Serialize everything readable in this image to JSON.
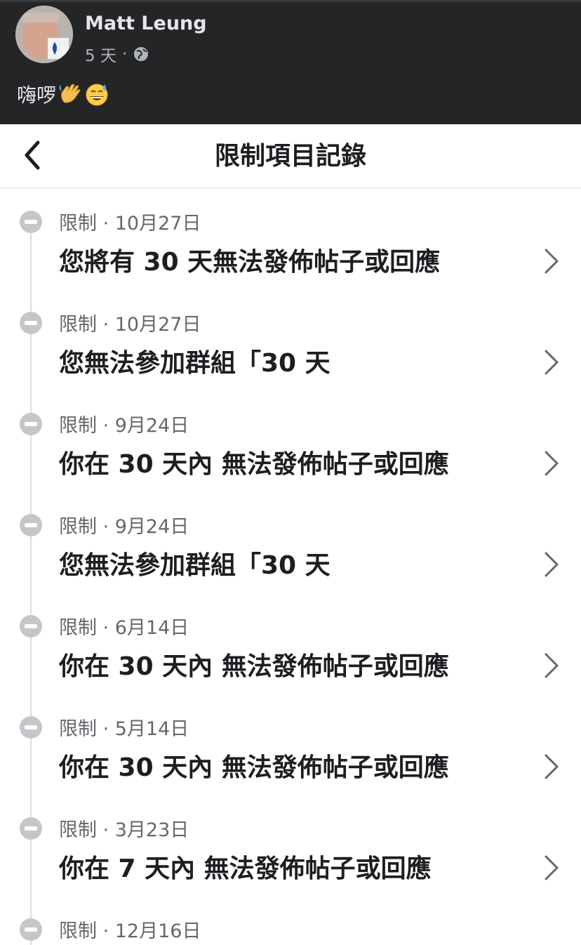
{
  "post": {
    "author": "Matt Leung",
    "time": "5 天",
    "separator": "·",
    "audience_icon": "globe-icon",
    "text": "嗨啰",
    "emojis": [
      "waving-hand-emoji",
      "grinning-sweat-emoji"
    ]
  },
  "header": {
    "title": "限制項目記錄",
    "back_icon": "chevron-left-icon"
  },
  "items": [
    {
      "label": "限制",
      "date": "10月27日",
      "text": "您將有 30 天無法發佈帖子或回應"
    },
    {
      "label": "限制",
      "date": "10月27日",
      "text": "您無法參加群組「30 天"
    },
    {
      "label": "限制",
      "date": "9月24日",
      "text": "你在 30 天內 無法發佈帖子或回應"
    },
    {
      "label": "限制",
      "date": "9月24日",
      "text": "您無法參加群組「30 天"
    },
    {
      "label": "限制",
      "date": "6月14日",
      "text": "你在 30 天內 無法發佈帖子或回應"
    },
    {
      "label": "限制",
      "date": "5月14日",
      "text": "你在 30 天內 無法發佈帖子或回應"
    },
    {
      "label": "限制",
      "date": "3月23日",
      "text": "你在 7 天內 無法發佈帖子或回應"
    },
    {
      "label": "限制",
      "date": "12月16日",
      "text": ""
    }
  ],
  "colors": {
    "post_bg": "#242526",
    "text_primary": "#1c1e21",
    "text_secondary": "#65676b",
    "timeline": "#dadde1"
  }
}
